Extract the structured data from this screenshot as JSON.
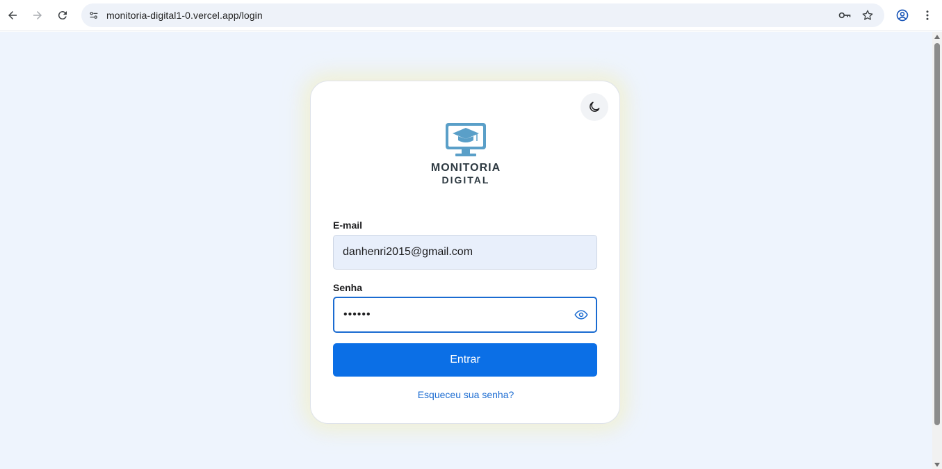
{
  "browser": {
    "url": "monitoria-digital1-0.vercel.app/login"
  },
  "logo": {
    "line1": "MONITORIA",
    "line2": "DIGITAL"
  },
  "form": {
    "email_label": "E-mail",
    "email_value": "danhenri2015@gmail.com",
    "password_label": "Senha",
    "password_masked": "••••••",
    "submit_label": "Entrar",
    "forgot_link": "Esqueceu sua senha?"
  },
  "colors": {
    "page_background": "#eef4fd",
    "primary": "#0b6fe6",
    "logo_accent": "#5a9fc8"
  }
}
